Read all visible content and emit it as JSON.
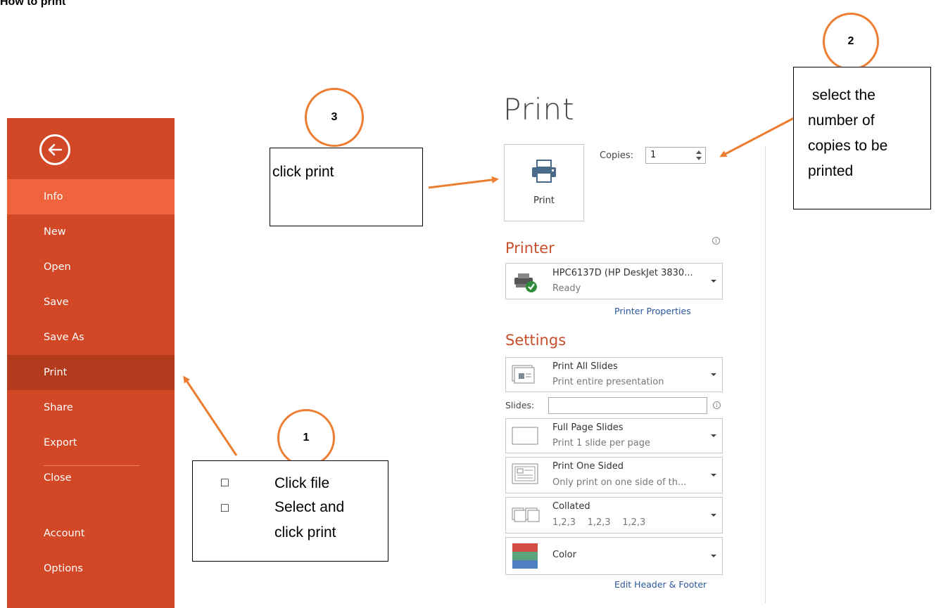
{
  "doc_title": "How to print",
  "sidebar": {
    "items": [
      {
        "label": "Info"
      },
      {
        "label": "New"
      },
      {
        "label": "Open"
      },
      {
        "label": "Save"
      },
      {
        "label": "Save As"
      },
      {
        "label": "Print"
      },
      {
        "label": "Share"
      },
      {
        "label": "Export"
      },
      {
        "label": "Close"
      },
      {
        "label": "Account"
      },
      {
        "label": "Options"
      }
    ]
  },
  "print_pane": {
    "heading": "Print",
    "print_button_label": "Print",
    "copies_label": "Copies:",
    "copies_value": "1",
    "printer": {
      "heading": "Printer",
      "name": "HPC6137D (HP DeskJet 3830...",
      "status": "Ready",
      "properties_link": "Printer Properties"
    },
    "settings": {
      "heading": "Settings",
      "range": {
        "title": "Print All Slides",
        "subtitle": "Print entire presentation"
      },
      "slides_label": "Slides:",
      "slides_value": "",
      "layout": {
        "title": "Full Page Slides",
        "subtitle": "Print 1 slide per page"
      },
      "sides": {
        "title": "Print One Sided",
        "subtitle": "Only print on one side of th..."
      },
      "collation": {
        "title": "Collated",
        "subtitle": "1,2,3    1,2,3    1,2,3"
      },
      "color": {
        "title": "Color"
      },
      "edit_header_link": "Edit Header & Footer"
    }
  },
  "annotations": {
    "step1": {
      "number": "1",
      "lines": [
        "Click file",
        "Select and",
        "click print"
      ],
      "bullet": "□"
    },
    "step2": {
      "number": "2",
      "text_lines": [
        "select the",
        "number of",
        "copies to be",
        "printed"
      ]
    },
    "step3": {
      "number": "3",
      "text": "click print"
    }
  },
  "colors": {
    "accent": "#d24726",
    "sidebar_active": "#f0643d",
    "sidebar_selected": "#b33b1d",
    "annotation": "#ed7d31",
    "heading": "#c5502b",
    "link": "#2b579a"
  }
}
